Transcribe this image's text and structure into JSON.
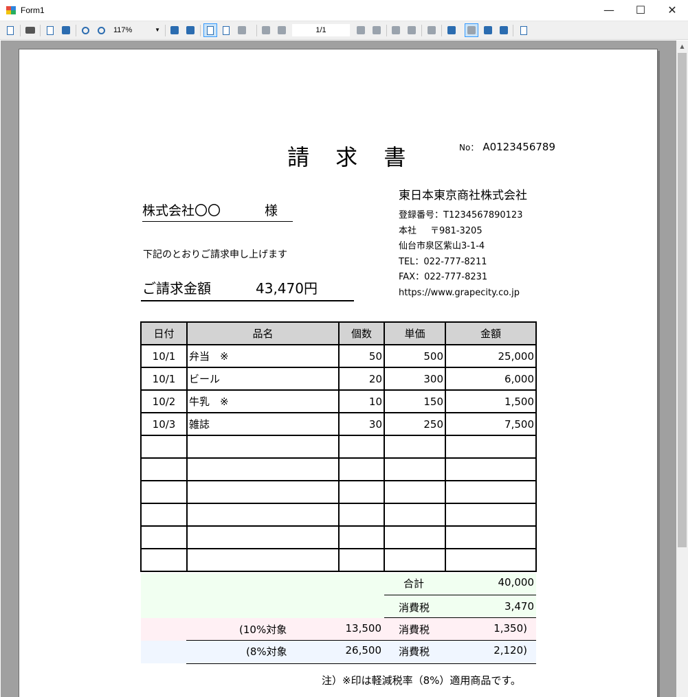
{
  "window": {
    "title": "Form1",
    "minimize": "—",
    "maximize": "☐",
    "close": "✕"
  },
  "toolbar": {
    "zoom": "117%",
    "page": "1/1"
  },
  "document": {
    "title": "請 求 書",
    "no_label": "No：",
    "no_value": "A0123456789",
    "customer": "株式会社〇〇",
    "honorific": "様",
    "intro": "下記のとおりご請求申し上げます",
    "amount_label": "ご請求金額",
    "amount_value": "43,470円",
    "company": {
      "name": "東日本東京商社株式会社",
      "registration": "登録番号：T1234567890123",
      "office_label": "本社",
      "postal": "〒981-3205",
      "address": "仙台市泉区紫山3-1-4",
      "tel": "TEL：022-777-8211",
      "fax": "FAX：022-777-8231",
      "url": "https://www.grapecity.co.jp"
    },
    "table": {
      "headers": {
        "date": "日付",
        "item": "品名",
        "qty": "個数",
        "price": "単価",
        "amount": "金額"
      },
      "rows": [
        {
          "date": "10/1",
          "item": "弁当　※",
          "qty": "50",
          "price": "500",
          "amount": "25,000"
        },
        {
          "date": "10/1",
          "item": "ビール",
          "qty": "20",
          "price": "300",
          "amount": "6,000"
        },
        {
          "date": "10/2",
          "item": "牛乳　※",
          "qty": "10",
          "price": "150",
          "amount": "1,500"
        },
        {
          "date": "10/3",
          "item": "雑誌",
          "qty": "30",
          "price": "250",
          "amount": "7,500"
        }
      ]
    },
    "totals": {
      "subtotal_label": "合計",
      "subtotal": "40,000",
      "tax_label": "消費税",
      "tax": "3,470",
      "rate10_label": "(10%対象",
      "rate10_base": "13,500",
      "rate10_tax_label": "消費税",
      "rate10_tax": "1,350)",
      "rate8_label": "(8%対象",
      "rate8_base": "26,500",
      "rate8_tax_label": "消費税",
      "rate8_tax": "2,120)"
    },
    "note": "注）※印は軽減税率（8%）適用商品です。"
  }
}
